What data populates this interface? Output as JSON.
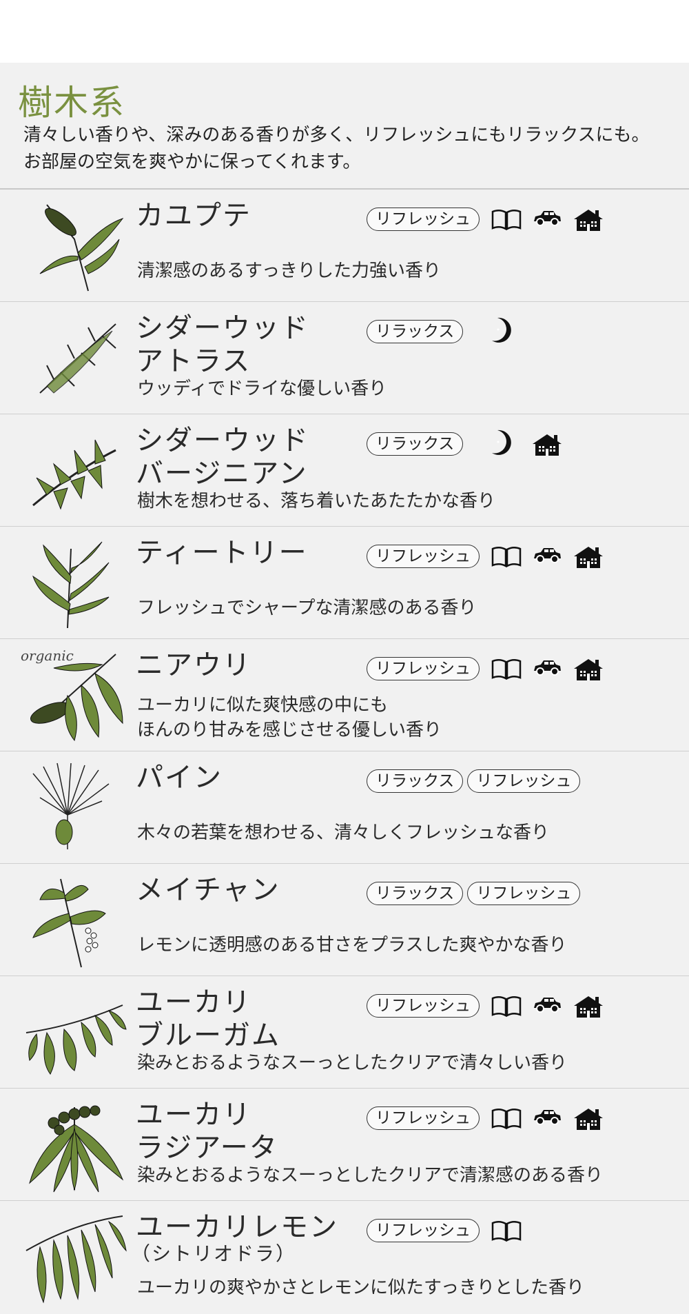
{
  "header": {
    "title": "樹木系",
    "description_line1": "清々しい香りや、深みのある香りが多く、リフレッシュにもリラックスにも。",
    "description_line2": "お部屋の空気を爽やかに保ってくれます。"
  },
  "items": [
    {
      "name": "カユプテ",
      "tags": [
        "リフレッシュ"
      ],
      "icons": [
        "book-icon",
        "car-icon",
        "house-icon"
      ],
      "desc": "清潔感のあるすっきりした力強い香り"
    },
    {
      "name": "シダーウッド\nアトラス",
      "tags": [
        "リラックス"
      ],
      "icons": [
        "moon-icon"
      ],
      "desc": "ウッディでドライな優しい香り"
    },
    {
      "name": "シダーウッド\nバージニアン",
      "tags": [
        "リラックス"
      ],
      "icons": [
        "moon-icon",
        "house-icon"
      ],
      "desc": "樹木を想わせる、落ち着いたあたたかな香り"
    },
    {
      "name": "ティートリー",
      "tags": [
        "リフレッシュ"
      ],
      "icons": [
        "book-icon",
        "car-icon",
        "house-icon"
      ],
      "desc": "フレッシュでシャープな清潔感のある香り"
    },
    {
      "name": "ニアウリ",
      "tags": [
        "リフレッシュ"
      ],
      "icons": [
        "book-icon",
        "car-icon",
        "house-icon"
      ],
      "desc": "ユーカリに似た爽快感の中にも\nほんのり甘みを感じさせる優しい香り",
      "organic": "organic"
    },
    {
      "name": "パイン",
      "tags": [
        "リラックス",
        "リフレッシュ"
      ],
      "icons": [],
      "desc": "木々の若葉を想わせる、清々しくフレッシュな香り"
    },
    {
      "name": "メイチャン",
      "tags": [
        "リラックス",
        "リフレッシュ"
      ],
      "icons": [],
      "desc": "レモンに透明感のある甘さをプラスした爽やかな香り"
    },
    {
      "name": "ユーカリ\nブルーガム",
      "tags": [
        "リフレッシュ"
      ],
      "icons": [
        "book-icon",
        "car-icon",
        "house-icon"
      ],
      "desc": "染みとおるようなスーっとしたクリアで清々しい香り"
    },
    {
      "name": "ユーカリ\nラジアータ",
      "tags": [
        "リフレッシュ"
      ],
      "icons": [
        "book-icon",
        "car-icon",
        "house-icon"
      ],
      "desc": "染みとおるようなスーっとしたクリアで清潔感のある香り"
    },
    {
      "name": "ユーカリレモン",
      "name_sub": "（シトリオドラ）",
      "tags": [
        "リフレッシュ"
      ],
      "icons": [
        "book-icon"
      ],
      "desc": "ユーカリの爽やかさとレモンに似たすっきりとした香り"
    }
  ],
  "colors": {
    "accent": "#7a9140",
    "leaf": "#6e8a3a",
    "ink": "#222222"
  }
}
